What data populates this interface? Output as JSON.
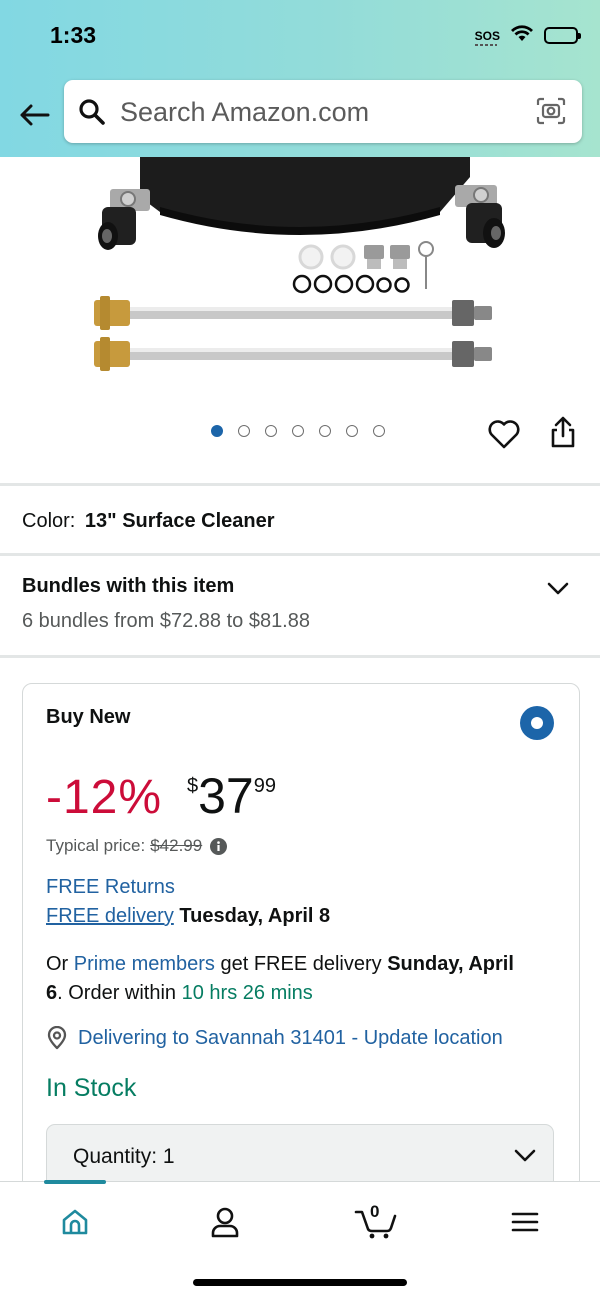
{
  "status_bar": {
    "time": "1:33",
    "sos": "SOS"
  },
  "search": {
    "placeholder": "Search Amazon.com"
  },
  "gallery": {
    "image_count": 7,
    "active_index": 0
  },
  "color": {
    "label": "Color:",
    "value": "13\" Surface Cleaner"
  },
  "bundles": {
    "title": "Bundles with this item",
    "subtitle": "6 bundles from $72.88 to $81.88"
  },
  "buy_box": {
    "title": "Buy New",
    "discount": "-12%",
    "price_symbol": "$",
    "price_whole": "37",
    "price_fraction": "99",
    "typical_label": "Typical price:",
    "typical_price": "$42.99",
    "free_returns": "FREE Returns",
    "free_delivery": "FREE delivery",
    "delivery_date": "Tuesday, April 8",
    "prime_or": "Or",
    "prime_link": "Prime members",
    "prime_text": "get FREE delivery",
    "prime_date_a": "Sunday, April",
    "prime_date_b": "6",
    "order_within_label": ". Order within",
    "order_within": "10 hrs 26 mins",
    "location": "Delivering to Savannah 31401 - Update location",
    "stock": "In Stock",
    "quantity_label": "Quantity:",
    "quantity_value": "1"
  },
  "bottom_nav": {
    "cart_count": "0"
  },
  "colors": {
    "accent": "#1c65a9",
    "link": "#2162a1",
    "deal_red": "#cc0c39",
    "stock_green": "#067d62"
  }
}
